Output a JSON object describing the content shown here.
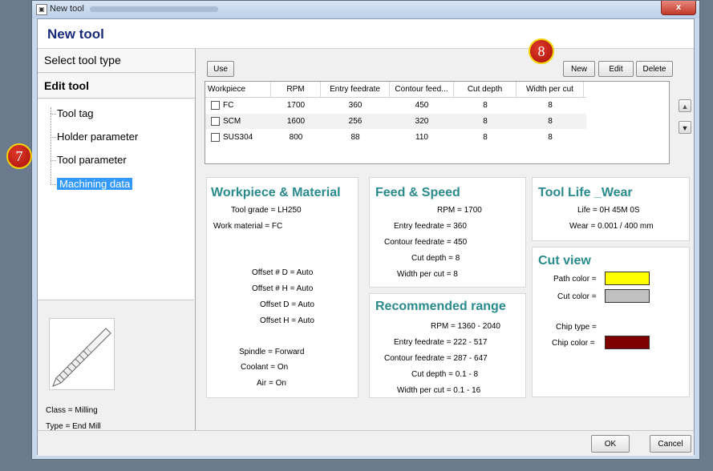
{
  "window": {
    "title": "New tool",
    "close_label": "x"
  },
  "header": {
    "title": "New tool"
  },
  "left": {
    "select_tool_type": "Select tool type",
    "edit_tool": "Edit tool",
    "tree": [
      "Tool tag",
      "Holder parameter",
      "Tool parameter",
      "Machining data"
    ],
    "class_line": "Class = Milling",
    "type_line": "Type = End Mill"
  },
  "toolbar": {
    "use": "Use",
    "new": "New",
    "edit": "Edit",
    "delete": "Delete"
  },
  "grid": {
    "columns": [
      "Workpiece",
      "RPM",
      "Entry feedrate",
      "Contour feed...",
      "Cut depth",
      "Width per cut"
    ],
    "rows": [
      [
        "FC",
        "1700",
        "360",
        "450",
        "8",
        "8"
      ],
      [
        "SCM",
        "1600",
        "256",
        "320",
        "8",
        "8"
      ],
      [
        "SUS304",
        "800",
        "88",
        "110",
        "8",
        "8"
      ]
    ]
  },
  "workpiece": {
    "title": "Workpiece & Material",
    "tool_grade": "Tool grade =  LH250",
    "work_material": "Work material =  FC",
    "offset_d_num": "Offset # D =  Auto",
    "offset_h_num": "Offset # H =  Auto",
    "offset_d": "Offset D =  Auto",
    "offset_h": "Offset H =  Auto",
    "spindle": "Spindle =  Forward",
    "coolant": "Coolant =  On",
    "air": "Air =  On"
  },
  "feed": {
    "title": "Feed & Speed",
    "rpm": "RPM =  1700",
    "entry": "Entry feedrate =  360",
    "contour": "Contour feedrate =  450",
    "cut_depth": "Cut depth =  8",
    "width": "Width per cut =  8"
  },
  "recommended": {
    "title": "Recommended range",
    "rpm": "RPM =  1360 - 2040",
    "entry": "Entry feedrate =  222 - 517",
    "contour": "Contour feedrate =  287 - 647",
    "cut_depth": "Cut depth =  0.1 - 8",
    "width": "Width per cut =  0.1 - 16"
  },
  "toollife": {
    "title": "Tool Life _Wear",
    "life": "Life =  0H 45M 0S",
    "wear": "Wear =  0.001 / 400 mm"
  },
  "cutview": {
    "title": "Cut view",
    "path_color": "Path color =",
    "cut_color": "Cut color =",
    "chip_type": "Chip type =",
    "chip_color": "Chip color =",
    "path_swatch": "#ffff00",
    "cut_swatch": "#c0c0c0",
    "chip_swatch": "#800000"
  },
  "footer": {
    "ok": "OK",
    "cancel": "Cancel"
  },
  "badges": {
    "b7": "7",
    "b8": "8"
  }
}
